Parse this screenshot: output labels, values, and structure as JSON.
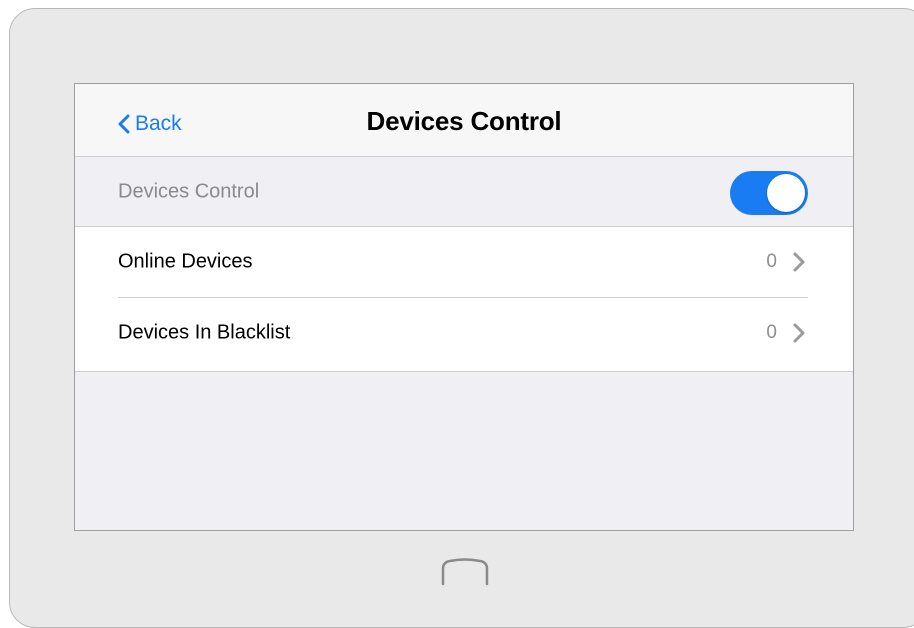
{
  "navbar": {
    "back_label": "Back",
    "title": "Devices Control"
  },
  "toggle_row": {
    "label": "Devices Control",
    "enabled": true
  },
  "list": [
    {
      "label": "Online Devices",
      "count": "0"
    },
    {
      "label": "Devices In Blacklist",
      "count": "0"
    }
  ],
  "icons": {
    "back": "chevron-left-icon",
    "row_arrow": "chevron-right-icon",
    "home": "home-button-icon"
  },
  "colors": {
    "accent": "#1a7cf2",
    "background": "#efeff4",
    "device_frame": "#e9e9e9"
  }
}
